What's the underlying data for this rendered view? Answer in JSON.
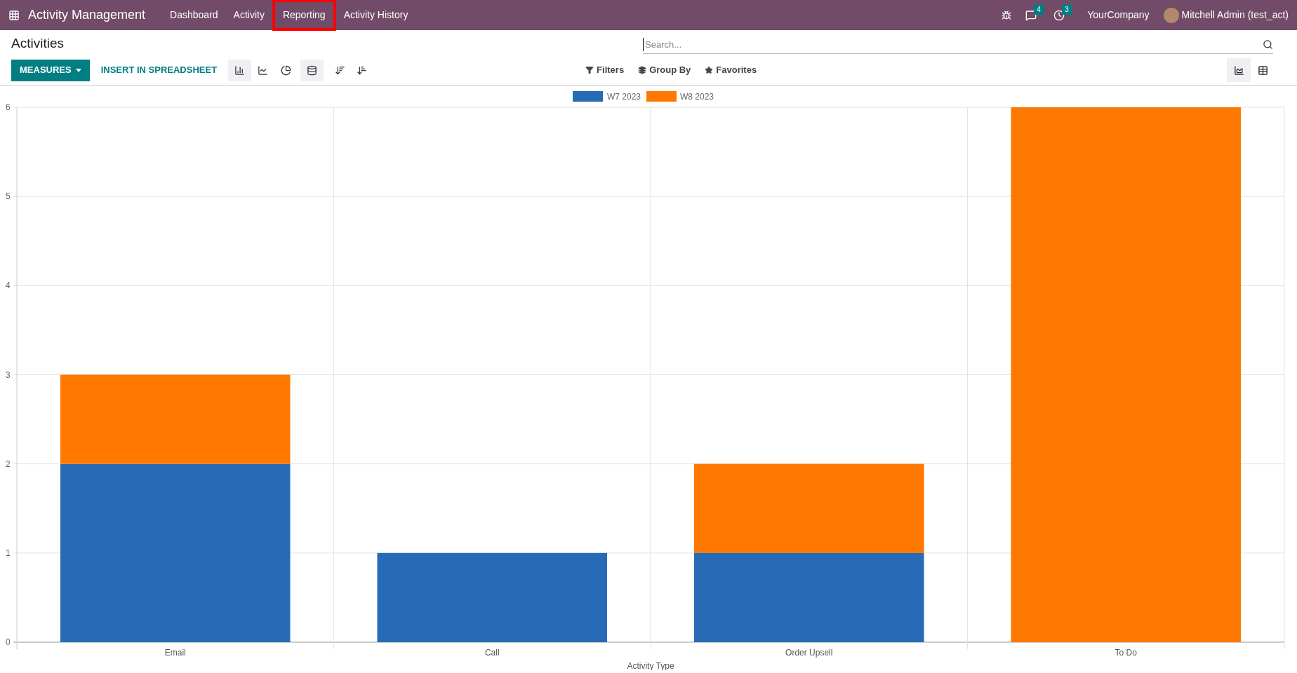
{
  "navbar": {
    "app_name": "Activity Management",
    "menu": [
      {
        "label": "Dashboard",
        "highlighted": false
      },
      {
        "label": "Activity",
        "highlighted": false
      },
      {
        "label": "Reporting",
        "highlighted": true
      },
      {
        "label": "Activity History",
        "highlighted": false
      }
    ],
    "messages_count": "4",
    "activities_count": "3",
    "company": "YourCompany",
    "user": "Mitchell Admin (test_act)"
  },
  "control_panel": {
    "title": "Activities",
    "search": {
      "placeholder": "Search..."
    },
    "measures_button": "MEASURES",
    "spreadsheet_button": "INSERT IN SPREADSHEET",
    "chart_modes": [
      {
        "kind": "bar",
        "selected": true
      },
      {
        "kind": "line",
        "selected": false
      },
      {
        "kind": "pie",
        "selected": false
      }
    ],
    "stacked": true,
    "filters": [
      "Filters",
      "Group By",
      "Favorites"
    ],
    "views": [
      {
        "kind": "graph",
        "selected": true
      },
      {
        "kind": "pivot",
        "selected": false
      }
    ]
  },
  "chart": {
    "chart_data": {
      "type": "bar",
      "grid": true,
      "legend": "top",
      "xlabel": "Activity Type",
      "categories": [
        "Email",
        "Call",
        "Order Upsell",
        "To Do"
      ],
      "stacked": true,
      "ylim": [
        0,
        6
      ],
      "yticks": [
        0,
        1,
        2,
        3,
        4,
        5,
        6
      ],
      "series": [
        {
          "name": "W7 2023",
          "color": "#276bb7",
          "values": [
            2,
            1,
            1,
            0
          ]
        },
        {
          "name": "W8 2023",
          "color": "#ff7800",
          "values": [
            1,
            0,
            1,
            6
          ]
        }
      ]
    }
  }
}
